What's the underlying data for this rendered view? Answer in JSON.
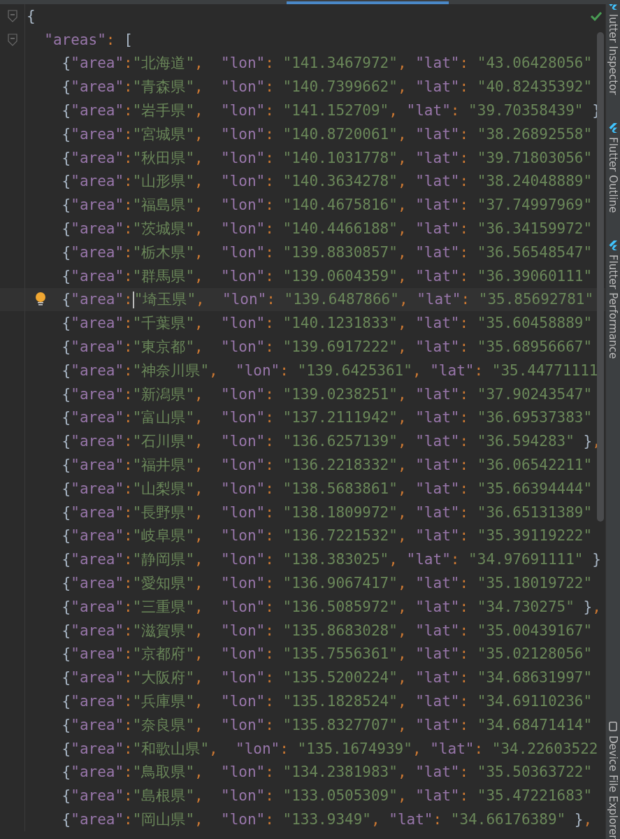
{
  "editor": {
    "lines": [
      {
        "text": "{",
        "foldable": true,
        "current": false
      },
      {
        "text": "  \"areas\": [",
        "foldable": true,
        "current": false
      },
      {
        "text": "    {\"area\":\"北海道\",  \"lon\": \"141.3467972\", \"lat\": \"43.06428056\"",
        "foldable": false,
        "current": false
      },
      {
        "text": "    {\"area\":\"青森県\",  \"lon\": \"140.7399662\", \"lat\": \"40.82435392\"",
        "foldable": false,
        "current": false
      },
      {
        "text": "    {\"area\":\"岩手県\",  \"lon\": \"141.152709\", \"lat\": \"39.70358439\" }",
        "foldable": false,
        "current": false
      },
      {
        "text": "    {\"area\":\"宮城県\",  \"lon\": \"140.8720061\", \"lat\": \"38.26892558\"",
        "foldable": false,
        "current": false
      },
      {
        "text": "    {\"area\":\"秋田県\",  \"lon\": \"140.1031778\", \"lat\": \"39.71803056\"",
        "foldable": false,
        "current": false
      },
      {
        "text": "    {\"area\":\"山形県\",  \"lon\": \"140.3634278\", \"lat\": \"38.24048889\"",
        "foldable": false,
        "current": false
      },
      {
        "text": "    {\"area\":\"福島県\",  \"lon\": \"140.4675816\", \"lat\": \"37.74997969\"",
        "foldable": false,
        "current": false
      },
      {
        "text": "    {\"area\":\"茨城県\",  \"lon\": \"140.4466188\", \"lat\": \"36.34159972\"",
        "foldable": false,
        "current": false
      },
      {
        "text": "    {\"area\":\"栃木県\",  \"lon\": \"139.8830857\", \"lat\": \"36.56548547\"",
        "foldable": false,
        "current": false
      },
      {
        "text": "    {\"area\":\"群馬県\",  \"lon\": \"139.0604359\", \"lat\": \"36.39060111\"",
        "foldable": false,
        "current": false
      },
      {
        "text": "    {\"area\":",
        "after_caret": "\"埼玉県\",  \"lon\": \"139.6487866\", \"lat\": \"35.85692781\"",
        "foldable": false,
        "current": true
      },
      {
        "text": "    {\"area\":\"千葉県\",  \"lon\": \"140.1231833\", \"lat\": \"35.60458889\"",
        "foldable": false,
        "current": false
      },
      {
        "text": "    {\"area\":\"東京都\",  \"lon\": \"139.6917222\", \"lat\": \"35.68956667\"",
        "foldable": false,
        "current": false
      },
      {
        "text": "    {\"area\":\"神奈川県\",  \"lon\": \"139.6425361\", \"lat\": \"35.44771111",
        "foldable": false,
        "current": false
      },
      {
        "text": "    {\"area\":\"新潟県\",  \"lon\": \"139.0238251\", \"lat\": \"37.90243547\"",
        "foldable": false,
        "current": false
      },
      {
        "text": "    {\"area\":\"富山県\",  \"lon\": \"137.2111942\", \"lat\": \"36.69537383\"",
        "foldable": false,
        "current": false
      },
      {
        "text": "    {\"area\":\"石川県\",  \"lon\": \"136.6257139\", \"lat\": \"36.594283\" },",
        "foldable": false,
        "current": false
      },
      {
        "text": "    {\"area\":\"福井県\",  \"lon\": \"136.2218332\", \"lat\": \"36.06542211\"",
        "foldable": false,
        "current": false
      },
      {
        "text": "    {\"area\":\"山梨県\",  \"lon\": \"138.5683861\", \"lat\": \"35.66394444\"",
        "foldable": false,
        "current": false
      },
      {
        "text": "    {\"area\":\"長野県\",  \"lon\": \"138.1809972\", \"lat\": \"36.65131389\"",
        "foldable": false,
        "current": false
      },
      {
        "text": "    {\"area\":\"岐阜県\",  \"lon\": \"136.7221532\", \"lat\": \"35.39119222\"",
        "foldable": false,
        "current": false
      },
      {
        "text": "    {\"area\":\"静岡県\",  \"lon\": \"138.383025\", \"lat\": \"34.97691111\" }",
        "foldable": false,
        "current": false
      },
      {
        "text": "    {\"area\":\"愛知県\",  \"lon\": \"136.9067417\", \"lat\": \"35.18019722\"",
        "foldable": false,
        "current": false
      },
      {
        "text": "    {\"area\":\"三重県\",  \"lon\": \"136.5085972\", \"lat\": \"34.730275\" },",
        "foldable": false,
        "current": false
      },
      {
        "text": "    {\"area\":\"滋賀県\",  \"lon\": \"135.8683028\", \"lat\": \"35.00439167\"",
        "foldable": false,
        "current": false
      },
      {
        "text": "    {\"area\":\"京都府\",  \"lon\": \"135.7556361\", \"lat\": \"35.02128056\"",
        "foldable": false,
        "current": false
      },
      {
        "text": "    {\"area\":\"大阪府\",  \"lon\": \"135.5200224\", \"lat\": \"34.68631997\"",
        "foldable": false,
        "current": false
      },
      {
        "text": "    {\"area\":\"兵庫県\",  \"lon\": \"135.1828524\", \"lat\": \"34.69110236\"",
        "foldable": false,
        "current": false
      },
      {
        "text": "    {\"area\":\"奈良県\",  \"lon\": \"135.8327707\", \"lat\": \"34.68471414\"",
        "foldable": false,
        "current": false
      },
      {
        "text": "    {\"area\":\"和歌山県\",  \"lon\": \"135.1674939\", \"lat\": \"34.22603522",
        "foldable": false,
        "current": false
      },
      {
        "text": "    {\"area\":\"鳥取県\",  \"lon\": \"134.2381983\", \"lat\": \"35.50363722\"",
        "foldable": false,
        "current": false
      },
      {
        "text": "    {\"area\":\"島根県\",  \"lon\": \"133.0505309\", \"lat\": \"35.47221683\"",
        "foldable": false,
        "current": false
      },
      {
        "text": "    {\"area\":\"岡山県\",  \"lon\": \"133.9349\", \"lat\": \"34.66176389\" },",
        "foldable": false,
        "current": false
      }
    ]
  },
  "tool_windows": [
    {
      "label": "lutter Inspector",
      "kind": "flutter"
    },
    {
      "label": "Flutter Outline",
      "kind": "flutter"
    },
    {
      "label": "Flutter Performance",
      "kind": "flutter"
    },
    {
      "label": "Device File Explorer",
      "kind": "device"
    }
  ]
}
